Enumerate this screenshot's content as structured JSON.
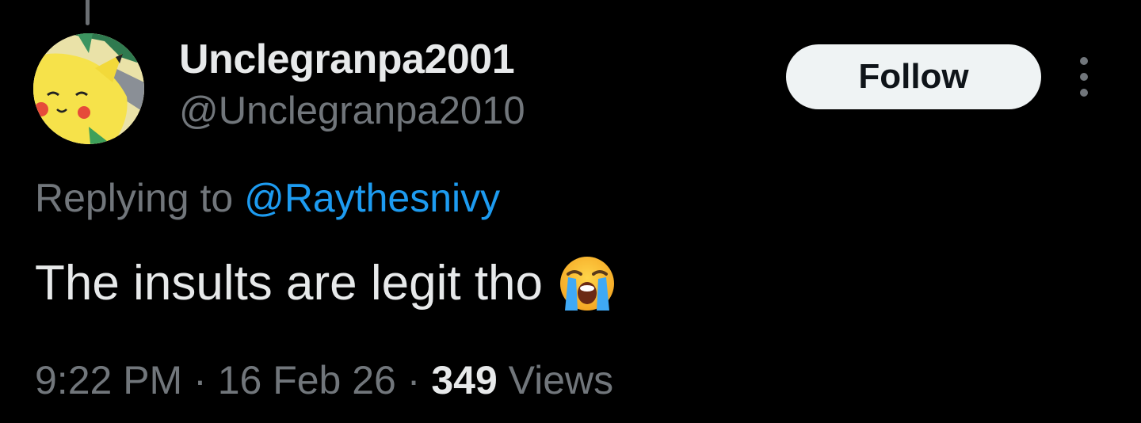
{
  "tweet": {
    "author": {
      "display_name": "Unclegranpa2001",
      "handle": "@Unclegranpa2010",
      "avatar_icon": "pikachu-avatar-icon"
    },
    "follow_label": "Follow",
    "more_icon": "more-vertical-icon",
    "reply_prefix": "Replying to",
    "reply_to": "@Raythesnivy",
    "text": "The insults are legit tho",
    "emoji_icon": "loudly-crying-face-icon",
    "time": "9:22 PM",
    "date": "16 Feb 26",
    "separator": "·",
    "views_count": "349",
    "views_label": "Views"
  },
  "colors": {
    "background": "#000000",
    "primary_text": "#e7e9ea",
    "secondary_text": "#71767b",
    "link": "#1d9bf0",
    "follow_bg": "#eff3f4",
    "follow_text": "#0f1419"
  }
}
